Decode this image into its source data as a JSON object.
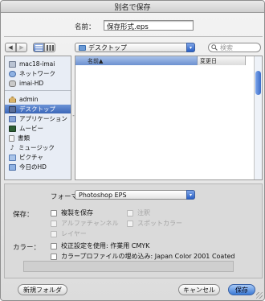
{
  "window": {
    "title": "別名で保存"
  },
  "save_as": {
    "label": "名前：",
    "filename": "保存形式.eps"
  },
  "nav": {
    "back_icon": "back-arrow-icon",
    "forward_icon": "forward-arrow-icon",
    "location": "デスクトップ",
    "search_placeholder": "検索"
  },
  "sidebar": {
    "devices": [
      {
        "label": "mac18-imai",
        "icon": "computer-icon"
      },
      {
        "label": "ネットワーク",
        "icon": "network-icon"
      },
      {
        "label": "imai-HD",
        "icon": "harddisk-icon"
      }
    ],
    "places": [
      {
        "label": "admin",
        "icon": "home-icon"
      },
      {
        "label": "デスクトップ",
        "icon": "desktop-icon",
        "selected": true
      },
      {
        "label": "アプリケーション",
        "icon": "applications-icon"
      },
      {
        "label": "ムービー",
        "icon": "movies-icon"
      },
      {
        "label": "書類",
        "icon": "documents-icon"
      },
      {
        "label": "ミュージック",
        "icon": "music-icon"
      },
      {
        "label": "ピクチャ",
        "icon": "pictures-icon"
      },
      {
        "label": "今日のHD",
        "icon": "folder-icon"
      }
    ]
  },
  "filelist": {
    "col_name": "名前",
    "col_date": "変更日"
  },
  "format": {
    "label": "フォーマット：",
    "value": "Photoshop EPS"
  },
  "save_options": {
    "label": "保存：",
    "as_copy": "複製を保存",
    "notes": "注釈",
    "alpha": "アルファチャンネル",
    "spot": "スポットカラー",
    "layers": "レイヤー"
  },
  "color": {
    "label": "カラー：",
    "proof": "校正設定を使用: 作業用 CMYK",
    "icc": "カラープロファイルの埋め込み: Japan Color 2001 Coated"
  },
  "buttons": {
    "new_folder": "新規フォルダ",
    "cancel": "キャンセル",
    "save": "保存"
  },
  "colors": {
    "accent": "#3b6cc8",
    "selection": "#3a66b8"
  }
}
